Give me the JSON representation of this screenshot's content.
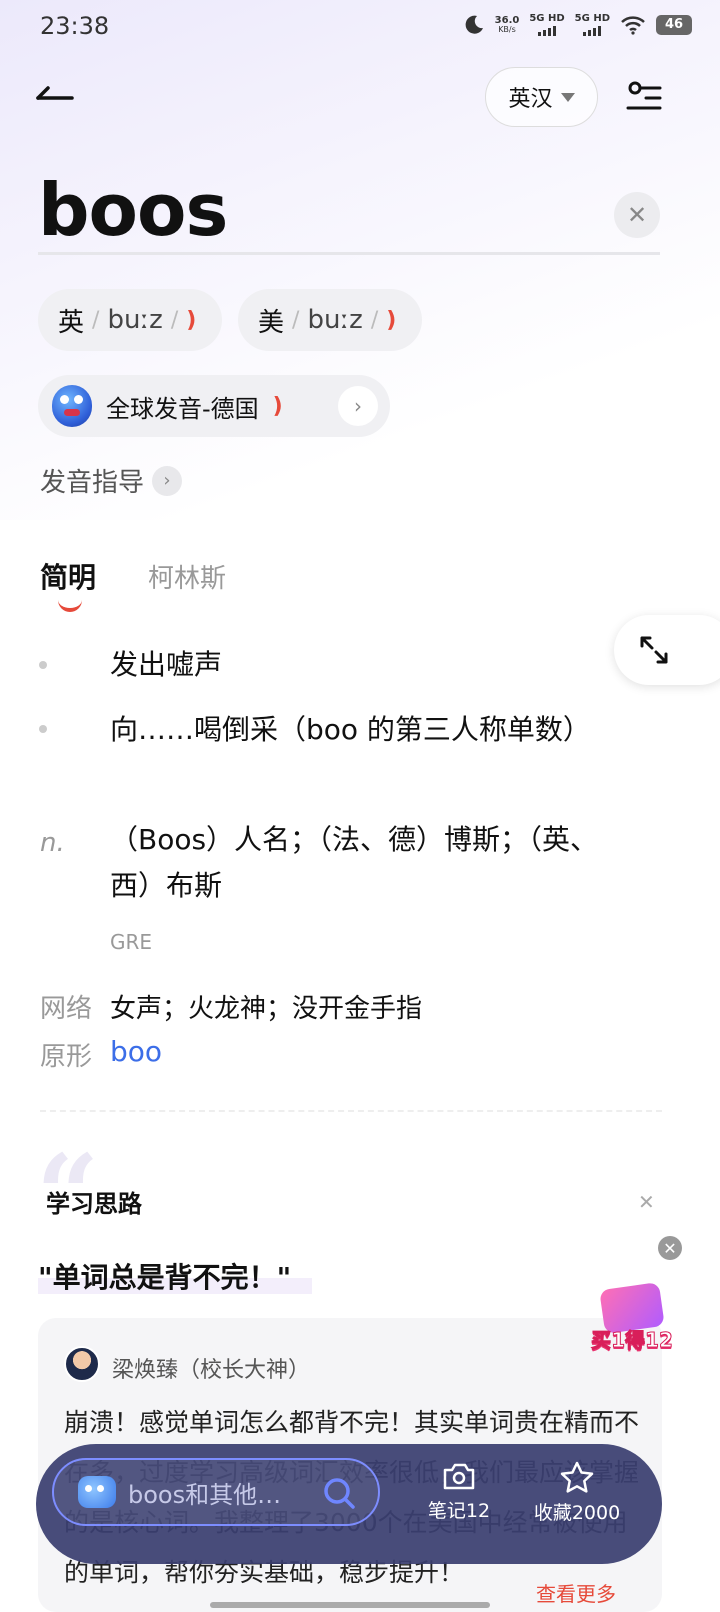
{
  "status": {
    "time": "23:38",
    "net_speed_value": "36.0",
    "net_speed_unit": "KB/s",
    "sim1": "5G HD",
    "sim2": "5G HD",
    "battery": "46"
  },
  "header": {
    "language": "英汉"
  },
  "entry": {
    "word": "boos",
    "pron_uk_label": "英",
    "pron_uk": "buːz",
    "pron_us_label": "美",
    "pron_us": "buːz",
    "global_pron": "全球发音-德国",
    "guide": "发音指导"
  },
  "tabs": [
    {
      "label": "简明"
    },
    {
      "label": "柯林斯"
    }
  ],
  "definitions": [
    {
      "text": "发出嘘声"
    },
    {
      "text": "向……喝倒采（boo 的第三人称单数）"
    },
    {
      "pos": "n.",
      "text": "（Boos）人名；（法、德）博斯；（英、西）布斯"
    }
  ],
  "tag": "GRE",
  "network": {
    "label": "网络",
    "text": "女声；火龙神；没开金手指"
  },
  "root": {
    "label": "原形",
    "word": "boo"
  },
  "study": {
    "title": "学习思路",
    "slogan": "\"单词总是背不完！\"",
    "author": "梁焕臻（校长大神）",
    "paragraph": "崩溃！感觉单词怎么都背不完！其实单词贵在精而不在多，过度学习高级词汇效率很低，我们最应该掌握的是核心词。我整理了3000个在美国中经常被使用的单词，帮你夯实基础，稳步提升！",
    "more": "查看更多"
  },
  "promo": {
    "text": "买1得12"
  },
  "bottom": {
    "search_placeholder": "boos和其他…",
    "notes": "笔记12",
    "favorites": "收藏2000"
  },
  "colors": {
    "accent": "#e64a3a",
    "link": "#3c6ee8",
    "bottom_bar": "#3a3e70"
  }
}
